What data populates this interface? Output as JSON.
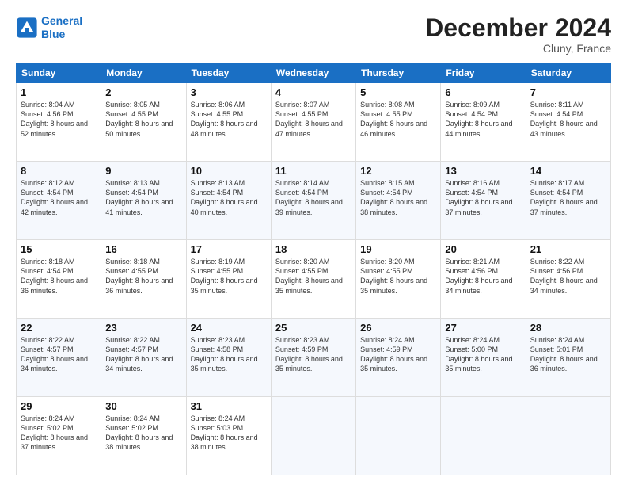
{
  "header": {
    "logo_line1": "General",
    "logo_line2": "Blue",
    "month_year": "December 2024",
    "location": "Cluny, France"
  },
  "weekdays": [
    "Sunday",
    "Monday",
    "Tuesday",
    "Wednesday",
    "Thursday",
    "Friday",
    "Saturday"
  ],
  "weeks": [
    [
      {
        "day": "1",
        "sunrise": "Sunrise: 8:04 AM",
        "sunset": "Sunset: 4:56 PM",
        "daylight": "Daylight: 8 hours and 52 minutes."
      },
      {
        "day": "2",
        "sunrise": "Sunrise: 8:05 AM",
        "sunset": "Sunset: 4:55 PM",
        "daylight": "Daylight: 8 hours and 50 minutes."
      },
      {
        "day": "3",
        "sunrise": "Sunrise: 8:06 AM",
        "sunset": "Sunset: 4:55 PM",
        "daylight": "Daylight: 8 hours and 48 minutes."
      },
      {
        "day": "4",
        "sunrise": "Sunrise: 8:07 AM",
        "sunset": "Sunset: 4:55 PM",
        "daylight": "Daylight: 8 hours and 47 minutes."
      },
      {
        "day": "5",
        "sunrise": "Sunrise: 8:08 AM",
        "sunset": "Sunset: 4:55 PM",
        "daylight": "Daylight: 8 hours and 46 minutes."
      },
      {
        "day": "6",
        "sunrise": "Sunrise: 8:09 AM",
        "sunset": "Sunset: 4:54 PM",
        "daylight": "Daylight: 8 hours and 44 minutes."
      },
      {
        "day": "7",
        "sunrise": "Sunrise: 8:11 AM",
        "sunset": "Sunset: 4:54 PM",
        "daylight": "Daylight: 8 hours and 43 minutes."
      }
    ],
    [
      {
        "day": "8",
        "sunrise": "Sunrise: 8:12 AM",
        "sunset": "Sunset: 4:54 PM",
        "daylight": "Daylight: 8 hours and 42 minutes."
      },
      {
        "day": "9",
        "sunrise": "Sunrise: 8:13 AM",
        "sunset": "Sunset: 4:54 PM",
        "daylight": "Daylight: 8 hours and 41 minutes."
      },
      {
        "day": "10",
        "sunrise": "Sunrise: 8:13 AM",
        "sunset": "Sunset: 4:54 PM",
        "daylight": "Daylight: 8 hours and 40 minutes."
      },
      {
        "day": "11",
        "sunrise": "Sunrise: 8:14 AM",
        "sunset": "Sunset: 4:54 PM",
        "daylight": "Daylight: 8 hours and 39 minutes."
      },
      {
        "day": "12",
        "sunrise": "Sunrise: 8:15 AM",
        "sunset": "Sunset: 4:54 PM",
        "daylight": "Daylight: 8 hours and 38 minutes."
      },
      {
        "day": "13",
        "sunrise": "Sunrise: 8:16 AM",
        "sunset": "Sunset: 4:54 PM",
        "daylight": "Daylight: 8 hours and 37 minutes."
      },
      {
        "day": "14",
        "sunrise": "Sunrise: 8:17 AM",
        "sunset": "Sunset: 4:54 PM",
        "daylight": "Daylight: 8 hours and 37 minutes."
      }
    ],
    [
      {
        "day": "15",
        "sunrise": "Sunrise: 8:18 AM",
        "sunset": "Sunset: 4:54 PM",
        "daylight": "Daylight: 8 hours and 36 minutes."
      },
      {
        "day": "16",
        "sunrise": "Sunrise: 8:18 AM",
        "sunset": "Sunset: 4:55 PM",
        "daylight": "Daylight: 8 hours and 36 minutes."
      },
      {
        "day": "17",
        "sunrise": "Sunrise: 8:19 AM",
        "sunset": "Sunset: 4:55 PM",
        "daylight": "Daylight: 8 hours and 35 minutes."
      },
      {
        "day": "18",
        "sunrise": "Sunrise: 8:20 AM",
        "sunset": "Sunset: 4:55 PM",
        "daylight": "Daylight: 8 hours and 35 minutes."
      },
      {
        "day": "19",
        "sunrise": "Sunrise: 8:20 AM",
        "sunset": "Sunset: 4:55 PM",
        "daylight": "Daylight: 8 hours and 35 minutes."
      },
      {
        "day": "20",
        "sunrise": "Sunrise: 8:21 AM",
        "sunset": "Sunset: 4:56 PM",
        "daylight": "Daylight: 8 hours and 34 minutes."
      },
      {
        "day": "21",
        "sunrise": "Sunrise: 8:22 AM",
        "sunset": "Sunset: 4:56 PM",
        "daylight": "Daylight: 8 hours and 34 minutes."
      }
    ],
    [
      {
        "day": "22",
        "sunrise": "Sunrise: 8:22 AM",
        "sunset": "Sunset: 4:57 PM",
        "daylight": "Daylight: 8 hours and 34 minutes."
      },
      {
        "day": "23",
        "sunrise": "Sunrise: 8:22 AM",
        "sunset": "Sunset: 4:57 PM",
        "daylight": "Daylight: 8 hours and 34 minutes."
      },
      {
        "day": "24",
        "sunrise": "Sunrise: 8:23 AM",
        "sunset": "Sunset: 4:58 PM",
        "daylight": "Daylight: 8 hours and 35 minutes."
      },
      {
        "day": "25",
        "sunrise": "Sunrise: 8:23 AM",
        "sunset": "Sunset: 4:59 PM",
        "daylight": "Daylight: 8 hours and 35 minutes."
      },
      {
        "day": "26",
        "sunrise": "Sunrise: 8:24 AM",
        "sunset": "Sunset: 4:59 PM",
        "daylight": "Daylight: 8 hours and 35 minutes."
      },
      {
        "day": "27",
        "sunrise": "Sunrise: 8:24 AM",
        "sunset": "Sunset: 5:00 PM",
        "daylight": "Daylight: 8 hours and 35 minutes."
      },
      {
        "day": "28",
        "sunrise": "Sunrise: 8:24 AM",
        "sunset": "Sunset: 5:01 PM",
        "daylight": "Daylight: 8 hours and 36 minutes."
      }
    ],
    [
      {
        "day": "29",
        "sunrise": "Sunrise: 8:24 AM",
        "sunset": "Sunset: 5:02 PM",
        "daylight": "Daylight: 8 hours and 37 minutes."
      },
      {
        "day": "30",
        "sunrise": "Sunrise: 8:24 AM",
        "sunset": "Sunset: 5:02 PM",
        "daylight": "Daylight: 8 hours and 38 minutes."
      },
      {
        "day": "31",
        "sunrise": "Sunrise: 8:24 AM",
        "sunset": "Sunset: 5:03 PM",
        "daylight": "Daylight: 8 hours and 38 minutes."
      },
      null,
      null,
      null,
      null
    ]
  ]
}
